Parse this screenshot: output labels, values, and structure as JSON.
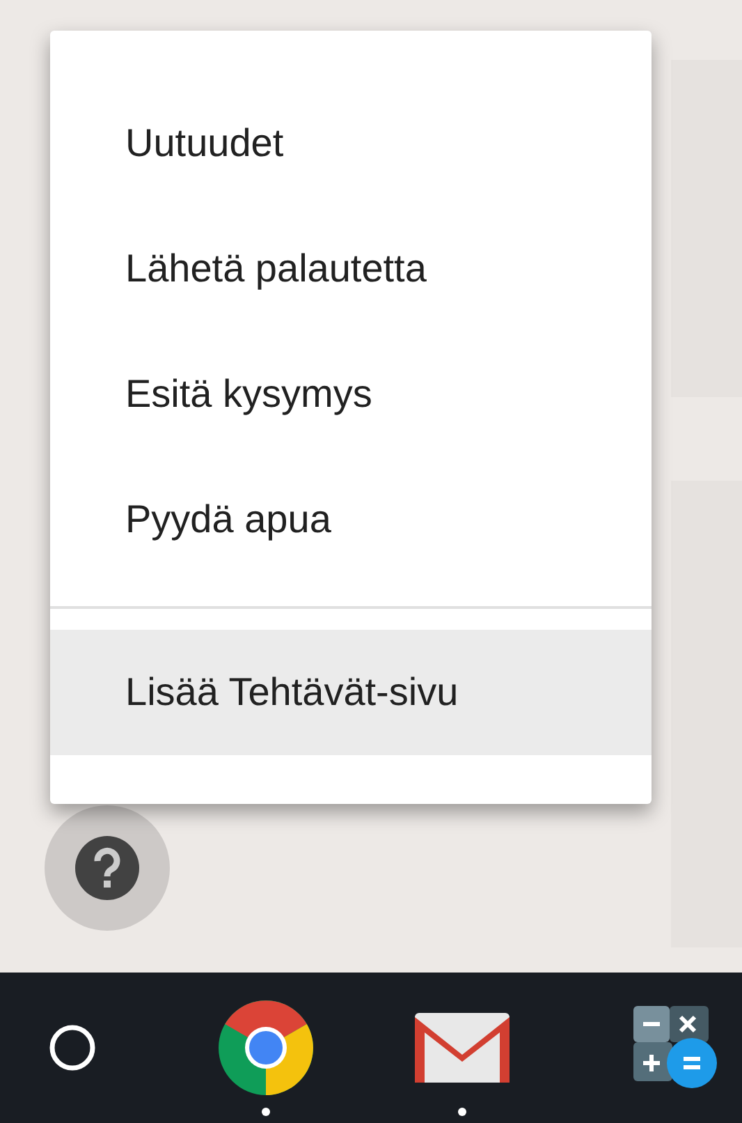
{
  "menu": {
    "sections": [
      {
        "items": [
          {
            "label": "Uutuudet",
            "selected": false
          },
          {
            "label": "Lähetä palautetta",
            "selected": false
          },
          {
            "label": "Esitä kysymys",
            "selected": false
          },
          {
            "label": "Pyydä apua",
            "selected": false
          }
        ]
      },
      {
        "items": [
          {
            "label": "Lisää Tehtävät-sivu",
            "selected": true
          }
        ]
      }
    ]
  },
  "shelf": {
    "apps": [
      {
        "kind": "chrome",
        "running": true
      },
      {
        "kind": "gmail",
        "running": true
      },
      {
        "kind": "calculator",
        "running": false
      }
    ]
  }
}
